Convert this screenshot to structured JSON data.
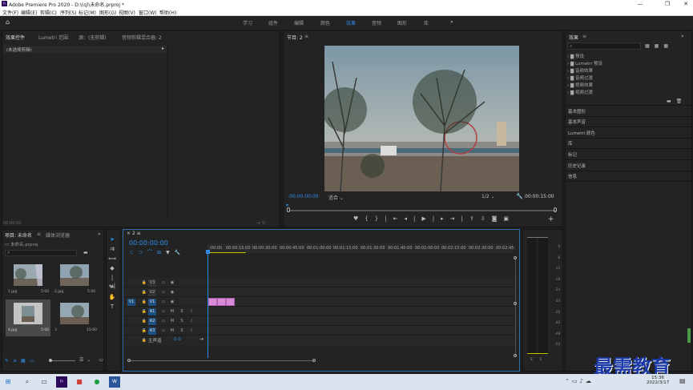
{
  "window": {
    "title": "Adobe Premiere Pro 2020 - D:\\(q)\\未命名.prproj *",
    "logo": "Pr"
  },
  "menus": [
    "文件(F)",
    "编辑(E)",
    "剪辑(C)",
    "序列(S)",
    "标记(M)",
    "图形(G)",
    "视图(V)",
    "窗口(W)",
    "帮助(H)"
  ],
  "workspaces": [
    "学习",
    "组件",
    "编辑",
    "颜色",
    "效果",
    "音频",
    "图形",
    "库"
  ],
  "active_workspace": "效果",
  "source": {
    "tabs": [
      "效果控件",
      "Lumetri 范围",
      "源：(无剪辑)",
      "音频剪辑混合器: 2"
    ],
    "no_clip": "(未选择剪辑)",
    "timecode": "00:00:00"
  },
  "program": {
    "tab": "节目: 2",
    "timecode_left": "00:00:00:00",
    "fit": "适合",
    "quality": "1/2",
    "timecode_right": "00:00:15:00"
  },
  "effects": {
    "tab": "效果",
    "items": [
      "预设",
      "Lumetri 预设",
      "音频效果",
      "音频过渡",
      "视频效果",
      "视频过渡"
    ],
    "sections": [
      "基本图形",
      "基本声音",
      "Lumetri 颜色",
      "库",
      "标记",
      "历史记录",
      "信息"
    ]
  },
  "project": {
    "tabs": [
      "项目: 未命名",
      "媒体浏览器"
    ],
    "name": "未命名.prproj",
    "items": [
      {
        "name": "1.jpg",
        "dur": "5:00"
      },
      {
        "name": "2.jpg",
        "dur": "5:00"
      },
      {
        "name": "4.jpg",
        "dur": "5:00"
      },
      {
        "name": "3",
        "dur": "15:00"
      }
    ]
  },
  "timeline": {
    "tab": "2",
    "timecode": "00:00:00:00",
    "ruler": [
      ":00:00",
      "00:00:15:00",
      "00:00:30:00",
      "00:00:45:00",
      "00:01:00:00",
      "00:01:15:00",
      "00:01:30:00",
      "00:01:45:00",
      "00:02:00:00",
      "00:02:15:00",
      "00:02:30:00",
      "00:02:45:"
    ],
    "tracks": [
      "V3",
      "V2",
      "V1",
      "A1",
      "A2",
      "A3"
    ],
    "source_patch": "V1",
    "master": "主声道",
    "master_val": "0.0"
  },
  "meter": {
    "scale": [
      "0",
      "-6",
      "-12",
      "-18",
      "-24",
      "-30",
      "-36",
      "-42",
      "-48",
      "-54",
      "dB"
    ],
    "labels": [
      "S",
      "S"
    ]
  },
  "taskbar": {
    "time": "15:36",
    "date": "2022/3/17"
  },
  "watermark": "最需教育"
}
